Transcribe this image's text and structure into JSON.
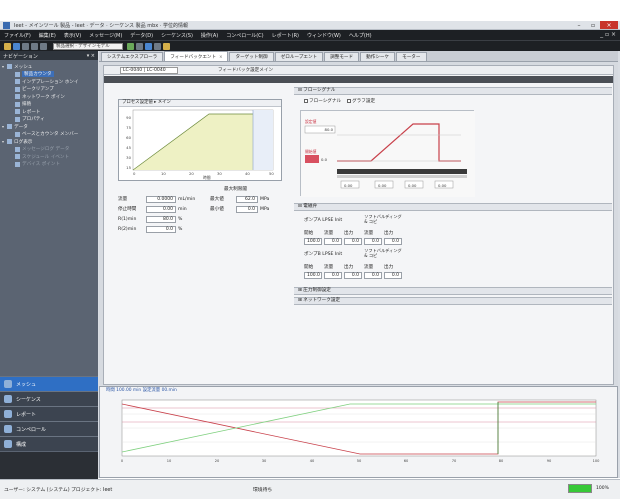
{
  "window": {
    "title": "Ieet - メインツール 製品 -  Ieet    ·   データ ·   シーケンス 製品 mbx · 学位的情報"
  },
  "menubar": {
    "items": [
      "ファイル(F)",
      "編集(E)",
      "表示(V)",
      "メッセージ(M)",
      "データ(D)",
      "シーケンス(S)",
      "操作(A)",
      "コンペロール(C)",
      "レポート(R)",
      "ウィンドウ(W)",
      "ヘルプ(H)"
    ],
    "right": "_ ▫ ×"
  },
  "toolbar": {
    "select_value": "製品選択 · デザインモデル"
  },
  "sidebar": {
    "header": "ナビゲーション",
    "pin": "▾ ×",
    "tree": [
      {
        "label": "メッシュ",
        "level": 0,
        "toggle": "▾"
      },
      {
        "label": "製品カウンタ",
        "level": 1,
        "selected": true
      },
      {
        "label": "インデプレーション ホンイ",
        "level": 1
      },
      {
        "label": "ピークリアンプ",
        "level": 1
      },
      {
        "label": "ネットワーク ポイン",
        "level": 1
      },
      {
        "label": "排熱",
        "level": 1
      },
      {
        "label": "レポート",
        "level": 1
      },
      {
        "label": "プロパティ",
        "level": 1
      },
      {
        "label": "データ",
        "level": 0,
        "toggle": "▾"
      },
      {
        "label": "ベースとカウンタ メンバー",
        "level": 1
      },
      {
        "label": "ログ表示",
        "level": 0,
        "toggle": "▾"
      },
      {
        "label": "メッセージログ データ",
        "level": 1,
        "dim": true
      },
      {
        "label": "スケジュール イベント",
        "level": 1,
        "dim": true
      },
      {
        "label": "デバイス ポイント",
        "level": 1,
        "dim": true
      }
    ],
    "nav": [
      "メッシュ",
      "シーケンス",
      "レポート",
      "コンペロール",
      "構成"
    ]
  },
  "tabs": [
    {
      "label": "システムエクスプローラ",
      "active": false
    },
    {
      "label": "フィードバックエント",
      "active": true
    },
    {
      "label": "ターゲット制御",
      "active": false
    },
    {
      "label": "ゼロループエント",
      "active": false
    },
    {
      "label": "調整モード",
      "active": false
    },
    {
      "label": "動作シーケ",
      "active": false
    },
    {
      "label": "モーター",
      "active": false
    }
  ],
  "panel": {
    "id_value": "LC-0040 | LC-0040",
    "name": "フィードバック設定メイン",
    "left_graph": {
      "header": "プロセス設定値  ▸ メイン",
      "y_ticks": [
        "90",
        "75",
        "60",
        "45",
        "30",
        "15"
      ],
      "x_ticks": [
        "0",
        "10",
        "20",
        "30",
        "40",
        "50"
      ],
      "xlabel": "時間"
    },
    "params": {
      "title": "最大制限閾",
      "flow_label": "流量",
      "flow_value": "0.0000",
      "flow_unit": "mL/min",
      "upper_label": "最大値",
      "upper_value": "62.0",
      "upper_unit": "MPa",
      "lower_label": "最小値",
      "lower_value": "0.0",
      "lower_unit": "MPa",
      "time_label": "停止時間",
      "time_value": "0.00",
      "time_unit": "min",
      "r1_label": "R(1)min",
      "r1_value": "80.0",
      "r1_unit": "%",
      "r2_label": "R(2)min",
      "r2_value": "0.0",
      "r2_unit": "%"
    },
    "right": {
      "section1": "⊟ フローシグナル",
      "opt_a": "フローシグナル",
      "opt_b": "グラフ設定",
      "graph_top_label": "設定値",
      "graph_top_value": "80.0",
      "graph_mid_label": "開始値",
      "graph_mid_value": "0.0",
      "cells": [
        "0.00",
        "0.00",
        "0.00",
        "0.00",
        "0.00"
      ],
      "section2": "⊟ 電磁弁",
      "pump_a": "ポンプA  LPSE  Init",
      "pump_a_note": "ソフトバルディング & コピ",
      "pump_b": "ポンプB  LPSE  Init",
      "pump_b_note": "ソフトバルディング & コピ",
      "grid_labels": [
        "開始",
        "流量",
        "出力",
        "流量",
        "出力"
      ],
      "grid_values": [
        "100.0",
        "0.0",
        "0.0",
        "0.0",
        "0.0"
      ],
      "section3": "⊞ 圧力制御設定",
      "section4": "⊞ ネットワーク設定"
    }
  },
  "bottom": {
    "header": "時間    100.00 min    設定流量    00.min",
    "ticks": [
      "0",
      "10",
      "20",
      "30",
      "40",
      "50",
      "60",
      "70",
      "80",
      "90",
      "100"
    ]
  },
  "status": {
    "left": "ユーザー: システム (システム) プロジェクト: Ieet",
    "mid": "環境待ち",
    "progress": 1.0,
    "zoom": "100%"
  },
  "colors": {
    "accent": "#2f6fc4",
    "graph_fill": "#eef1c4",
    "line_red": "#c8404a",
    "line_green": "#7fd07f",
    "line_pink": "#d88aa0"
  }
}
